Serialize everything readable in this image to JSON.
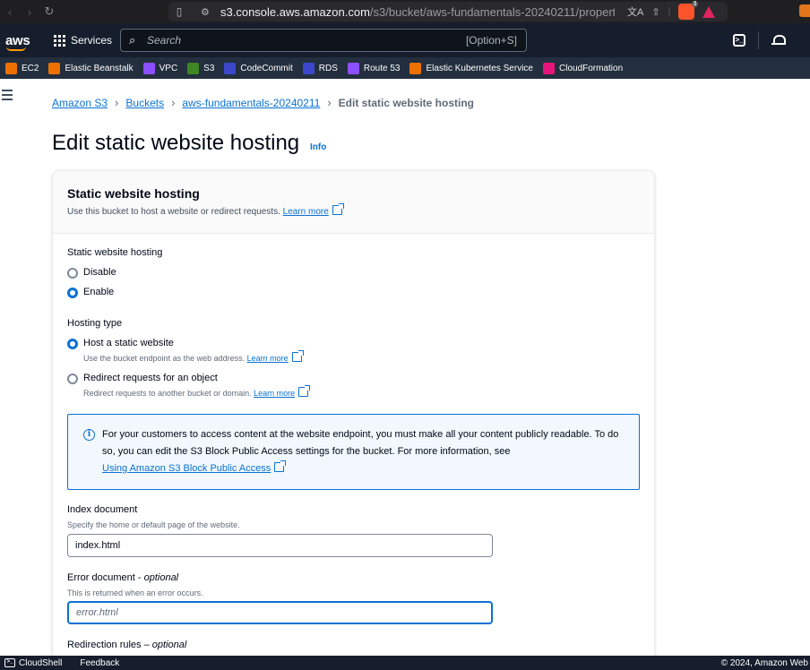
{
  "browser": {
    "url_host": "s3.console.aws.amazon.com",
    "url_path": "/s3/bucket/aws-fundamentals-20240211/propert...",
    "brave_badge": "3",
    "icons": [
      "back-icon",
      "forward-icon",
      "reload-icon",
      "bookmark-icon",
      "site-settings-icon",
      "translate-icon",
      "share-icon",
      "brave-shields-icon",
      "brave-rewards-icon",
      "metamask-icon"
    ]
  },
  "aws_nav": {
    "logo": "aws",
    "services_label": "Services",
    "search_placeholder": "Search",
    "search_shortcut": "[Option+S]"
  },
  "favorites": [
    {
      "label": "EC2",
      "color": "#ed7100",
      "icon": "ec2-icon"
    },
    {
      "label": "Elastic Beanstalk",
      "color": "#ed7100",
      "icon": "elastic-beanstalk-icon"
    },
    {
      "label": "VPC",
      "color": "#8c4fff",
      "icon": "vpc-icon"
    },
    {
      "label": "S3",
      "color": "#3f8624",
      "icon": "s3-icon"
    },
    {
      "label": "CodeCommit",
      "color": "#3b48cc",
      "icon": "codecommit-icon"
    },
    {
      "label": "RDS",
      "color": "#3b48cc",
      "icon": "rds-icon"
    },
    {
      "label": "Route 53",
      "color": "#8c4fff",
      "icon": "route53-icon"
    },
    {
      "label": "Elastic Kubernetes Service",
      "color": "#ed7100",
      "icon": "eks-icon"
    },
    {
      "label": "CloudFormation",
      "color": "#e7157b",
      "icon": "cloudformation-icon"
    }
  ],
  "breadcrumb": {
    "items": [
      "Amazon S3",
      "Buckets",
      "aws-fundamentals-20240211"
    ],
    "current": "Edit static website hosting"
  },
  "page": {
    "title": "Edit static website hosting",
    "info": "Info"
  },
  "container": {
    "title": "Static website hosting",
    "description": "Use this bucket to host a website or redirect requests.",
    "learn_more": "Learn more"
  },
  "hosting": {
    "label": "Static website hosting",
    "options": [
      {
        "label": "Disable",
        "checked": false
      },
      {
        "label": "Enable",
        "checked": true
      }
    ]
  },
  "hosting_type": {
    "label": "Hosting type",
    "options": [
      {
        "label": "Host a static website",
        "description": "Use the bucket endpoint as the web address.",
        "learn_more": "Learn more",
        "checked": true
      },
      {
        "label": "Redirect requests for an object",
        "description": "Redirect requests to another bucket or domain.",
        "learn_more": "Learn more",
        "checked": false
      }
    ]
  },
  "alert": {
    "text": "For your customers to access content at the website endpoint, you must make all your content publicly readable. To do so, you can edit the S3 Block Public Access settings for the bucket. For more information, see",
    "link": "Using Amazon S3 Block Public Access",
    "color": "#0972d3"
  },
  "index_document": {
    "label": "Index document",
    "description": "Specify the home or default page of the website.",
    "value": "index.html"
  },
  "error_document": {
    "label": "Error document",
    "label_suffix": "optional",
    "description": "This is returned when an error occurs.",
    "placeholder": "error.html"
  },
  "redirection_rules": {
    "label": "Redirection rules",
    "label_suffix": "optional"
  },
  "footer": {
    "cloudshell": "CloudShell",
    "feedback": "Feedback",
    "copyright": "© 2024, Amazon Web"
  }
}
